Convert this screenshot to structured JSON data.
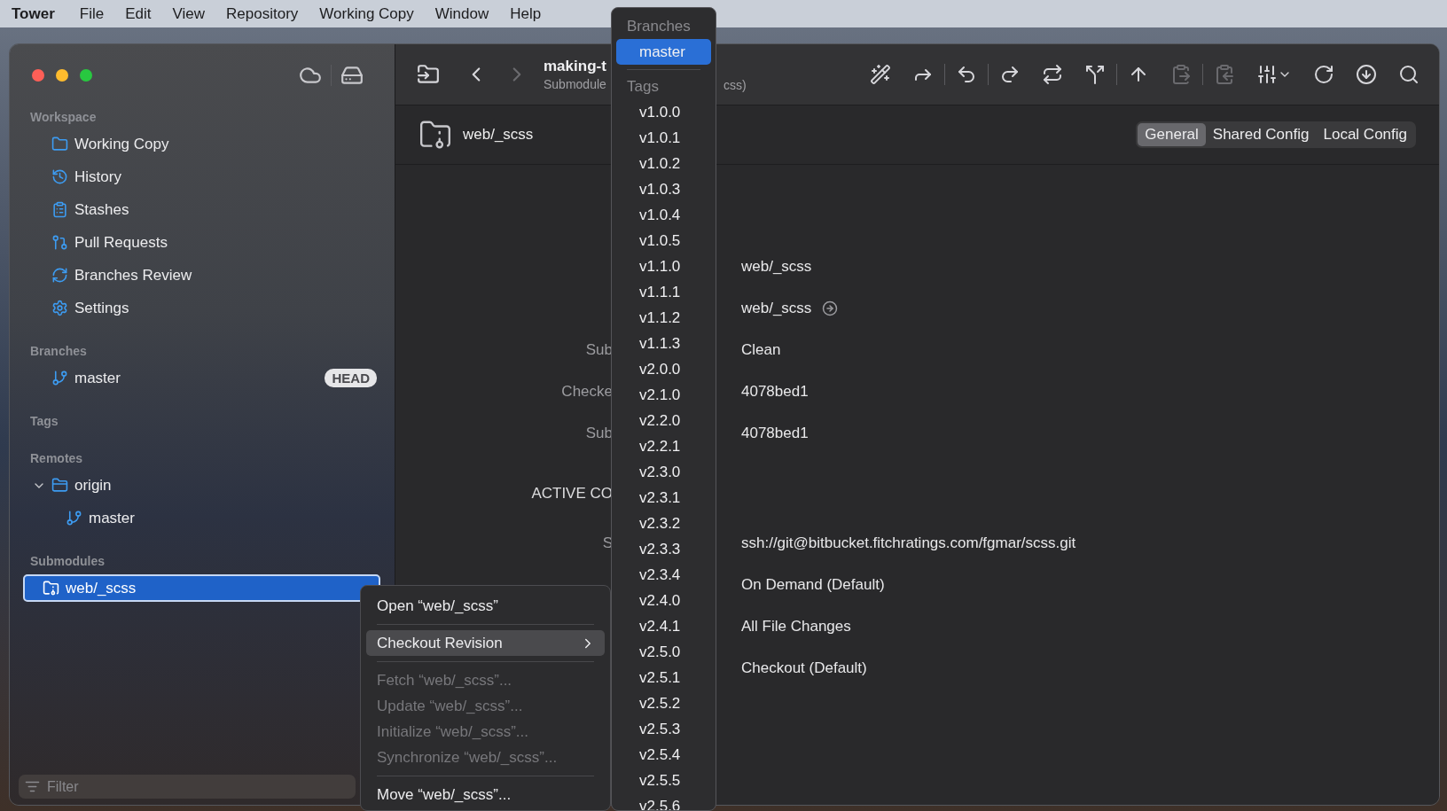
{
  "menu_bar": {
    "app": "Tower",
    "items": [
      "File",
      "Edit",
      "View",
      "Repository",
      "Working Copy",
      "Window",
      "Help"
    ]
  },
  "sidebar": {
    "workspace": {
      "title": "Workspace",
      "items": [
        {
          "label": "Working Copy",
          "selected": false
        },
        {
          "label": "History",
          "selected": false
        },
        {
          "label": "Stashes",
          "selected": false
        },
        {
          "label": "Pull Requests",
          "selected": false
        },
        {
          "label": "Branches Review",
          "selected": false
        },
        {
          "label": "Settings",
          "selected": false
        }
      ]
    },
    "branches": {
      "title": "Branches",
      "items": [
        {
          "label": "master",
          "badge": "HEAD",
          "selected": false
        }
      ]
    },
    "tags": {
      "title": "Tags"
    },
    "remotes": {
      "title": "Remotes",
      "items": [
        {
          "label": "origin",
          "expanded": true,
          "selected": false,
          "children": [
            {
              "label": "master",
              "selected": false
            }
          ]
        }
      ]
    },
    "submodules": {
      "title": "Submodules",
      "items": [
        {
          "label": "web/_scss",
          "selected": true
        }
      ]
    },
    "filter": {
      "placeholder": "Filter"
    }
  },
  "toolbar": {
    "title": "making-t",
    "subtitle": "Submodule",
    "subtitle_tail": "css)",
    "back": {
      "disabled": false
    },
    "forward": {
      "disabled": true
    },
    "actions": [
      {
        "disabled": false
      },
      {
        "disabled": false
      },
      {
        "disabled": false
      },
      {
        "disabled": false
      },
      {
        "disabled": false
      },
      {
        "disabled": false
      },
      {
        "disabled": false
      },
      {
        "disabled": true
      },
      {
        "disabled": true
      },
      {
        "disabled": false
      },
      {
        "disabled": false
      },
      {
        "disabled": false
      },
      {
        "disabled": false
      }
    ]
  },
  "header": {
    "title": "web/_scss",
    "tabs": [
      {
        "label": "General",
        "selected": true
      },
      {
        "label": "Shared Config",
        "selected": false
      },
      {
        "label": "Local Config",
        "selected": false
      }
    ]
  },
  "details": {
    "rows": [
      {
        "kind": "text",
        "value": "web/_scss"
      },
      {
        "kind": "link",
        "value": "web/_scss"
      },
      {
        "kind": "text",
        "label": "Sub",
        "value": "Clean"
      },
      {
        "kind": "text",
        "label": "Checke",
        "value": "4078bed1"
      },
      {
        "kind": "text",
        "label": "Sub",
        "value": "4078bed1"
      },
      {
        "kind": "section",
        "label": "ACTIVE CO"
      },
      {
        "kind": "text",
        "label": "S",
        "value": "ssh://git@bitbucket.fitchratings.com/fgmar/scss.git"
      },
      {
        "kind": "text",
        "value": "On Demand (Default)"
      },
      {
        "kind": "text",
        "value": "All File Changes"
      },
      {
        "kind": "text",
        "value": "Checkout (Default)"
      }
    ]
  },
  "context_menu": {
    "items": [
      {
        "kind": "item",
        "label": "Open “web/_scss”",
        "disabled": false,
        "selected": false
      },
      {
        "kind": "separator"
      },
      {
        "kind": "submenu",
        "label": "Checkout Revision",
        "disabled": false,
        "selected": true
      },
      {
        "kind": "separator"
      },
      {
        "kind": "item",
        "label": "Fetch “web/_scss”...",
        "disabled": true,
        "selected": false
      },
      {
        "kind": "item",
        "label": "Update “web/_scss”...",
        "disabled": true,
        "selected": false
      },
      {
        "kind": "item",
        "label": "Initialize “web/_scss”...",
        "disabled": true,
        "selected": false
      },
      {
        "kind": "item",
        "label": "Synchronize “web/_scss”...",
        "disabled": true,
        "selected": false
      },
      {
        "kind": "separator"
      },
      {
        "kind": "item",
        "label": "Move “web/_scss”...",
        "disabled": false,
        "selected": false
      }
    ]
  },
  "revision_menu": {
    "branches_title": "Branches",
    "branches": [
      {
        "label": "master",
        "selected": true
      }
    ],
    "tags_title": "Tags",
    "tags": [
      {
        "label": "v1.0.0",
        "selected": false
      },
      {
        "label": "v1.0.1",
        "selected": false
      },
      {
        "label": "v1.0.2",
        "selected": false
      },
      {
        "label": "v1.0.3",
        "selected": false
      },
      {
        "label": "v1.0.4",
        "selected": false
      },
      {
        "label": "v1.0.5",
        "selected": false
      },
      {
        "label": "v1.1.0",
        "selected": false
      },
      {
        "label": "v1.1.1",
        "selected": false
      },
      {
        "label": "v1.1.2",
        "selected": false
      },
      {
        "label": "v1.1.3",
        "selected": false
      },
      {
        "label": "v2.0.0",
        "selected": false
      },
      {
        "label": "v2.1.0",
        "selected": false
      },
      {
        "label": "v2.2.0",
        "selected": false
      },
      {
        "label": "v2.2.1",
        "selected": false
      },
      {
        "label": "v2.3.0",
        "selected": false
      },
      {
        "label": "v2.3.1",
        "selected": false
      },
      {
        "label": "v2.3.2",
        "selected": false
      },
      {
        "label": "v2.3.3",
        "selected": false
      },
      {
        "label": "v2.3.4",
        "selected": false
      },
      {
        "label": "v2.4.0",
        "selected": false
      },
      {
        "label": "v2.4.1",
        "selected": false
      },
      {
        "label": "v2.5.0",
        "selected": false
      },
      {
        "label": "v2.5.1",
        "selected": false
      },
      {
        "label": "v2.5.2",
        "selected": false
      },
      {
        "label": "v2.5.3",
        "selected": false
      },
      {
        "label": "v2.5.4",
        "selected": false
      },
      {
        "label": "v2.5.5",
        "selected": false
      },
      {
        "label": "v2.5.6",
        "selected": false
      }
    ]
  }
}
